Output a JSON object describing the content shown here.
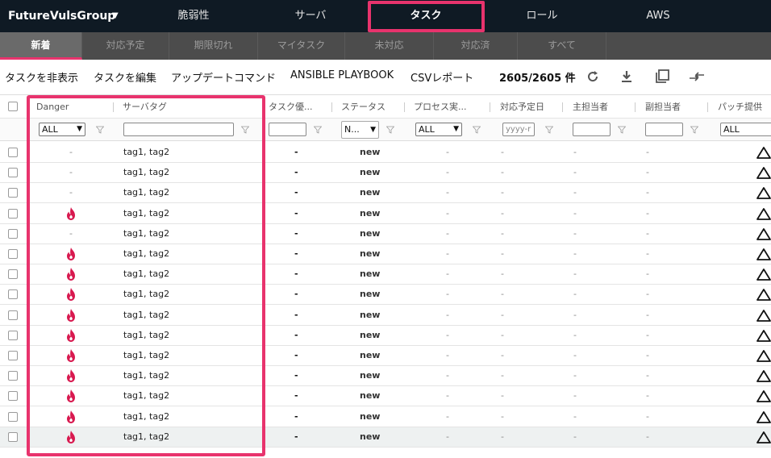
{
  "app": {
    "brand": "FutureVulsGroup",
    "nav": [
      "脆弱性",
      "サーバ",
      "タスク",
      "ロール",
      "AWS"
    ],
    "active_nav": "タスク"
  },
  "subtabs": [
    "新着",
    "対応予定",
    "期限切れ",
    "マイタスク",
    "未対応",
    "対応済",
    "すべて"
  ],
  "toolbar": {
    "hide_tasks": "タスクを非表示",
    "edit_tasks": "タスクを編集",
    "update_command": "アップデートコマンド",
    "ansible": "ANSIBLE PLAYBOOK",
    "csv": "CSVレポート",
    "count": "2605/2605 件",
    "icons": [
      "refresh-icon",
      "download-icon",
      "copy-icon",
      "swap-icon"
    ]
  },
  "columns": [
    "Danger",
    "サーバタグ",
    "タスク優...",
    "ステータス",
    "プロセス実...",
    "対応予定日",
    "主担当者",
    "副担当者",
    "パッチ提供"
  ],
  "filters": {
    "danger": "ALL",
    "priority_select": "N...",
    "process": "ALL",
    "date_placeholder": "yyyy-r",
    "patch": "ALL"
  },
  "rows": [
    {
      "danger": "-",
      "tags": "tag1, tag2",
      "priority": "-",
      "status": "new",
      "process": "-",
      "due": "-",
      "main": "-",
      "sub": "-",
      "fire": false
    },
    {
      "danger": "-",
      "tags": "tag1, tag2",
      "priority": "-",
      "status": "new",
      "process": "-",
      "due": "-",
      "main": "-",
      "sub": "-",
      "fire": false
    },
    {
      "danger": "-",
      "tags": "tag1, tag2",
      "priority": "-",
      "status": "new",
      "process": "-",
      "due": "-",
      "main": "-",
      "sub": "-",
      "fire": false
    },
    {
      "danger": "",
      "tags": "tag1, tag2",
      "priority": "-",
      "status": "new",
      "process": "-",
      "due": "-",
      "main": "-",
      "sub": "-",
      "fire": true
    },
    {
      "danger": "-",
      "tags": "tag1, tag2",
      "priority": "-",
      "status": "new",
      "process": "-",
      "due": "-",
      "main": "-",
      "sub": "-",
      "fire": false
    },
    {
      "danger": "",
      "tags": "tag1, tag2",
      "priority": "-",
      "status": "new",
      "process": "-",
      "due": "-",
      "main": "-",
      "sub": "-",
      "fire": true
    },
    {
      "danger": "",
      "tags": "tag1, tag2",
      "priority": "-",
      "status": "new",
      "process": "-",
      "due": "-",
      "main": "-",
      "sub": "-",
      "fire": true
    },
    {
      "danger": "",
      "tags": "tag1, tag2",
      "priority": "-",
      "status": "new",
      "process": "-",
      "due": "-",
      "main": "-",
      "sub": "-",
      "fire": true
    },
    {
      "danger": "",
      "tags": "tag1, tag2",
      "priority": "-",
      "status": "new",
      "process": "-",
      "due": "-",
      "main": "-",
      "sub": "-",
      "fire": true
    },
    {
      "danger": "",
      "tags": "tag1, tag2",
      "priority": "-",
      "status": "new",
      "process": "-",
      "due": "-",
      "main": "-",
      "sub": "-",
      "fire": true
    },
    {
      "danger": "",
      "tags": "tag1, tag2",
      "priority": "-",
      "status": "new",
      "process": "-",
      "due": "-",
      "main": "-",
      "sub": "-",
      "fire": true
    },
    {
      "danger": "",
      "tags": "tag1, tag2",
      "priority": "-",
      "status": "new",
      "process": "-",
      "due": "-",
      "main": "-",
      "sub": "-",
      "fire": true
    },
    {
      "danger": "",
      "tags": "tag1, tag2",
      "priority": "-",
      "status": "new",
      "process": "-",
      "due": "-",
      "main": "-",
      "sub": "-",
      "fire": true
    },
    {
      "danger": "",
      "tags": "tag1, tag2",
      "priority": "-",
      "status": "new",
      "process": "-",
      "due": "-",
      "main": "-",
      "sub": "-",
      "fire": true
    },
    {
      "danger": "",
      "tags": "tag1, tag2",
      "priority": "-",
      "status": "new",
      "process": "-",
      "due": "-",
      "main": "-",
      "sub": "-",
      "fire": true
    }
  ],
  "colors": {
    "accent": "#e8336d",
    "topbar": "#0f1a24",
    "subbar": "#4c4c4c",
    "fire": "#d8194f"
  }
}
